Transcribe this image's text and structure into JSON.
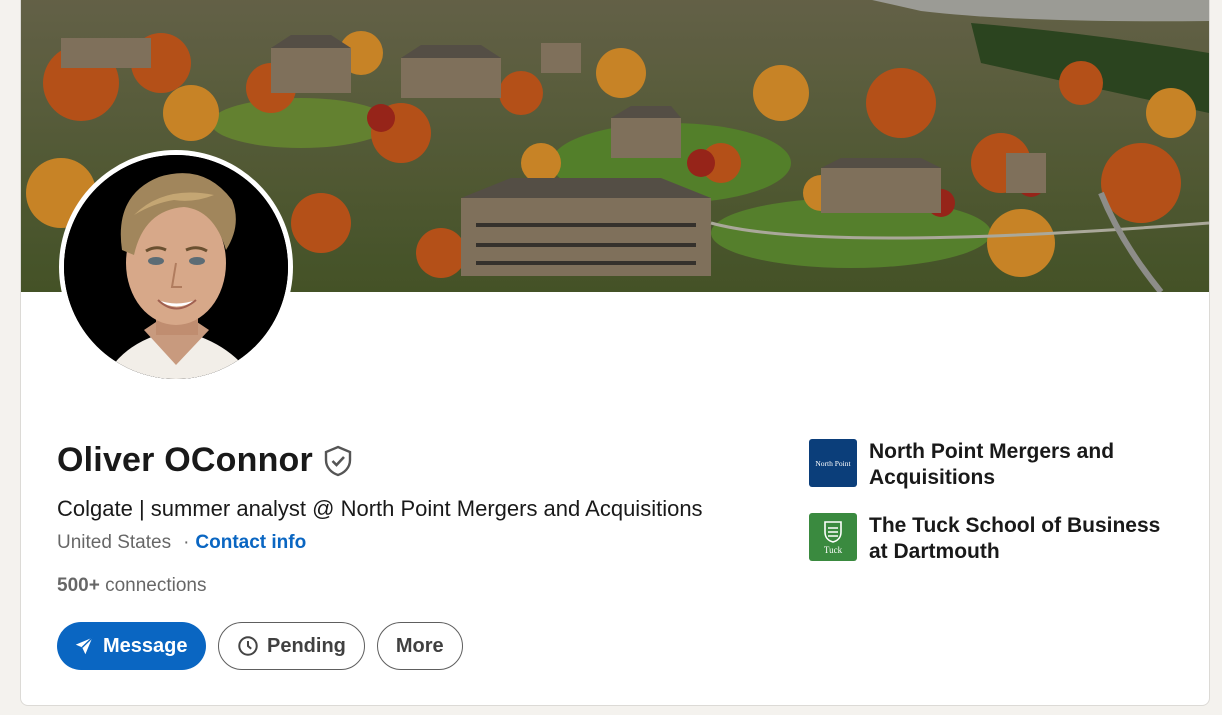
{
  "profile": {
    "name": "Oliver OConnor",
    "headline": "Colgate | summer analyst @ North Point Mergers and Acquisitions",
    "location": "United States",
    "separator": "·",
    "contact_info_label": "Contact info",
    "connections_count": "500+",
    "connections_label": "connections"
  },
  "actions": {
    "message_label": "Message",
    "pending_label": "Pending",
    "more_label": "More"
  },
  "organizations": [
    {
      "name": "North Point Mergers and Acquisitions",
      "logo_text": "North Point"
    },
    {
      "name": "The Tuck School of Business at Dartmouth",
      "logo_text": "Tuck"
    }
  ],
  "colors": {
    "primary": "#0a66c2",
    "north_point_logo": "#0b3e7a",
    "tuck_logo": "#3a8a3f"
  },
  "icons": [
    "verified-shield-icon",
    "send-icon",
    "clock-icon"
  ]
}
